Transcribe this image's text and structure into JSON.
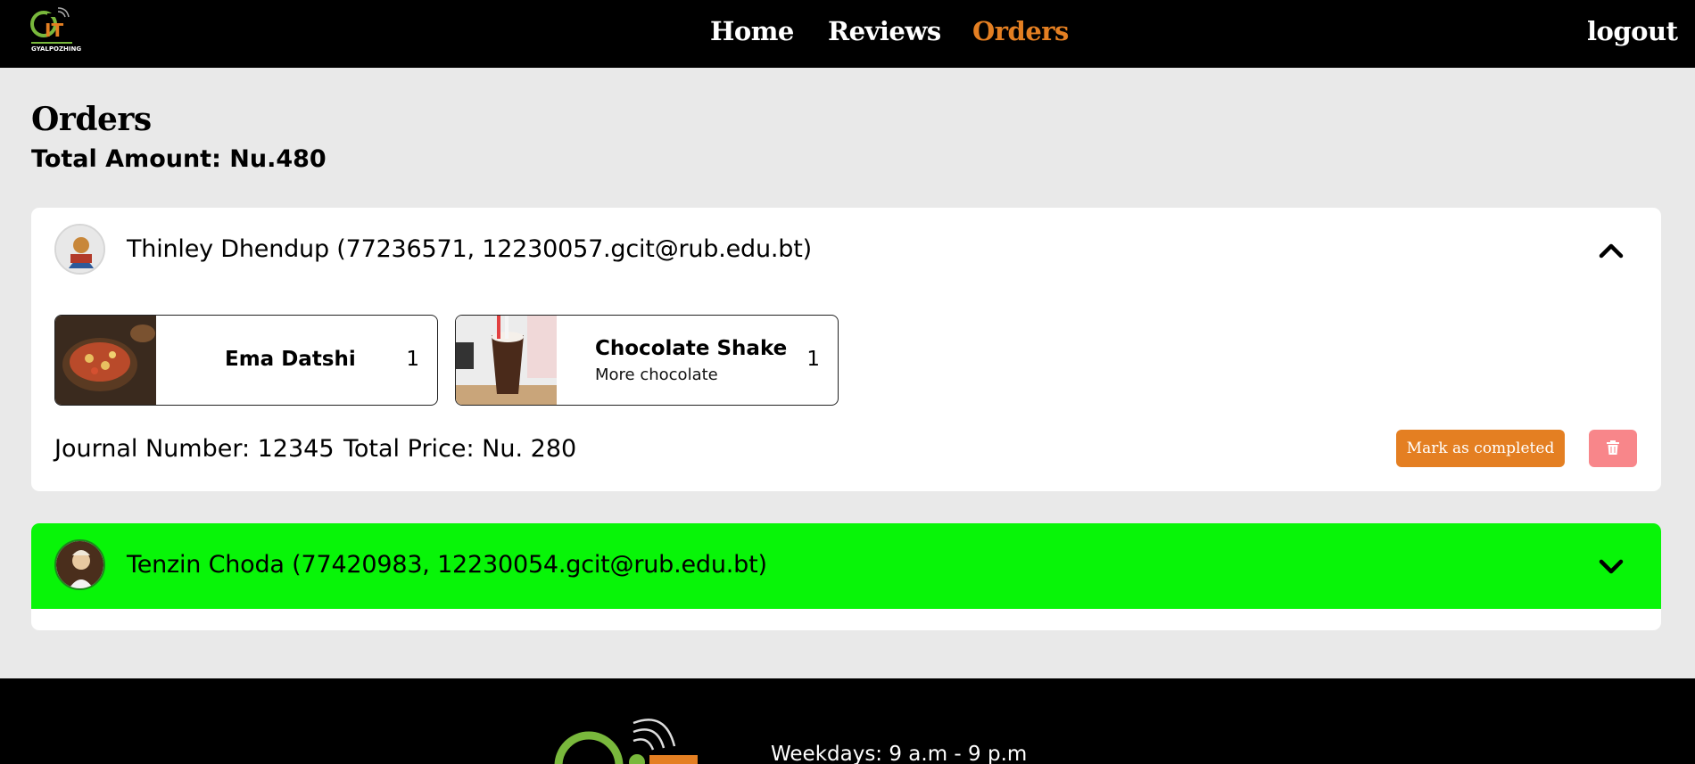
{
  "nav": {
    "logo_text": "GYALPOZHING",
    "links": [
      "Home",
      "Reviews",
      "Orders"
    ],
    "active": "Orders",
    "logout": "logout"
  },
  "page": {
    "title": "Orders",
    "total_amount": "Total Amount: Nu.480"
  },
  "orders": [
    {
      "customer": "Thinley Dhendup (77236571, 12230057.gcit@rub.edu.bt)",
      "expanded": true,
      "items": [
        {
          "name": "Ema Datshi",
          "description": "",
          "quantity": "1"
        },
        {
          "name": "Chocolate Shake",
          "description": "More chocolate",
          "quantity": "1"
        }
      ],
      "journal": "Journal Number: 12345",
      "total_price": "Total Price: Nu. 280",
      "complete_label": "Mark as completed"
    },
    {
      "customer": "Tenzin Choda (77420983, 12230054.gcit@rub.edu.bt)",
      "expanded": false,
      "highlight_color": "#08f508"
    }
  ],
  "footer": {
    "hours": "Weekdays: 9 a.m - 9 p.m"
  },
  "colors": {
    "accent": "#e47f22",
    "delete": "#f8868a",
    "completed": "#08f508"
  }
}
